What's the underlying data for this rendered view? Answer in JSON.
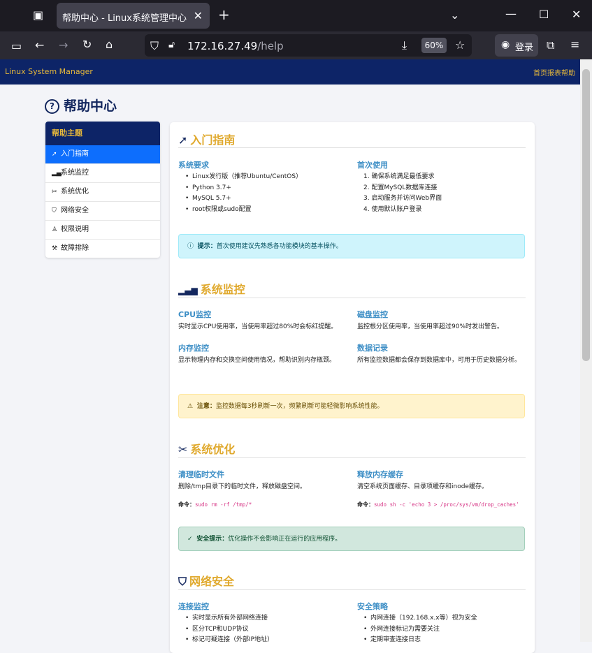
{
  "browser": {
    "tab_title": "帮助中心 - Linux系统管理中心",
    "url_host": "172.16.27.49",
    "url_path": "/help",
    "zoom": "60%",
    "login_label": "登录"
  },
  "app": {
    "brand": "Linux System Manager",
    "nav_link": "首页报表帮助"
  },
  "page": {
    "title": "帮助中心"
  },
  "sidebar": {
    "header": "帮助主题",
    "items": [
      {
        "label": "入门指南",
        "icon": "rocket-icon"
      },
      {
        "label": "系统监控",
        "icon": "bar-chart-icon"
      },
      {
        "label": "系统优化",
        "icon": "tools-icon"
      },
      {
        "label": "网络安全",
        "icon": "shield-icon"
      },
      {
        "label": "权限说明",
        "icon": "user-lock-icon"
      },
      {
        "label": "故障排除",
        "icon": "wrench-icon"
      }
    ]
  },
  "sections": {
    "intro": {
      "title": "入门指南",
      "req_title": "系统要求",
      "req_items": [
        "Linux发行版（推荐Ubuntu/CentOS）",
        "Python 3.7+",
        "MySQL 5.7+",
        "root权限或sudo配置"
      ],
      "first_title": "首次使用",
      "first_items": [
        "1. 确保系统满足最低要求",
        "2. 配置MySQL数据库连接",
        "3. 启动服务并访问Web界面",
        "4. 使用默认账户登录"
      ],
      "alert_label": "提示：",
      "alert_text": "首次使用建议先熟悉各功能模块的基本操作。"
    },
    "monitor": {
      "title": "系统监控",
      "cpu_title": "CPU监控",
      "cpu_text": "实时显示CPU使用率，当使用率超过80%时会标红提醒。",
      "disk_title": "磁盘监控",
      "disk_text": "监控根分区使用率，当使用率超过90%时发出警告。",
      "mem_title": "内存监控",
      "mem_text": "显示物理内存和交换空间使用情况，帮助识别内存瓶颈。",
      "data_title": "数据记录",
      "data_text": "所有监控数据都会保存到数据库中，可用于历史数据分析。",
      "alert_label": "注意：",
      "alert_text": "监控数据每3秒刷新一次，频繁刷新可能轻微影响系统性能。"
    },
    "optimize": {
      "title": "系统优化",
      "tmp_title": "清理临时文件",
      "tmp_text": "删除/tmp目录下的临时文件，释放磁盘空间。",
      "cmd_label": "命令：",
      "tmp_cmd": "sudo rm -rf /tmp/*",
      "cache_title": "释放内存缓存",
      "cache_text": "清空系统页面缓存、目录项缓存和inode缓存。",
      "cache_cmd": "sudo sh -c 'echo 3 > /proc/sys/vm/drop_caches'",
      "alert_label": "安全提示：",
      "alert_text": "优化操作不会影响正在运行的应用程序。"
    },
    "security": {
      "title": "网络安全",
      "conn_title": "连接监控",
      "conn_items": [
        "实时显示所有外部网络连接",
        "区分TCP和UDP协议",
        "标记可疑连接（外部IP地址）"
      ],
      "policy_title": "安全策略",
      "policy_items": [
        "内网连接（192.168.x.x等）视为安全",
        "外网连接标记为需要关注",
        "定期审查连接日志"
      ]
    }
  }
}
